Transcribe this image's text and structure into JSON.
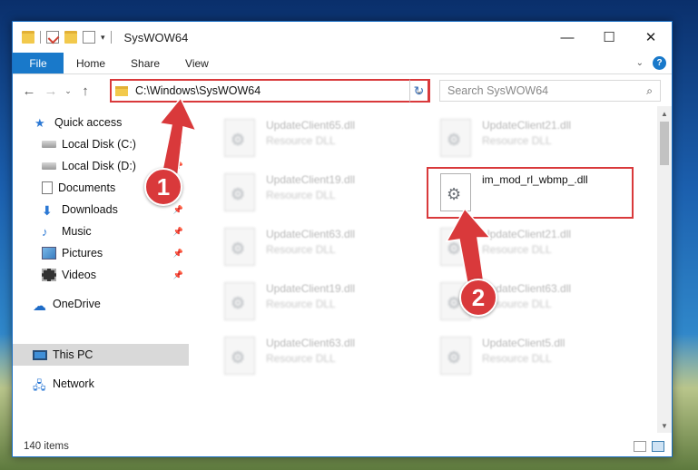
{
  "window": {
    "title": "SysWOW64",
    "buttons": {
      "minimize": "—",
      "maximize": "☐",
      "close": "✕"
    }
  },
  "ribbon": {
    "tabs": [
      "File",
      "Home",
      "Share",
      "View"
    ],
    "help": "?"
  },
  "navigation": {
    "address": "C:\\Windows\\SysWOW64",
    "search_placeholder": "Search SysWOW64"
  },
  "sidebar": {
    "items": [
      {
        "label": "Quick access",
        "icon": "star-icon"
      },
      {
        "label": "Local Disk (C:)",
        "icon": "disk-icon",
        "pinned": true
      },
      {
        "label": "Local Disk (D:)",
        "icon": "disk-icon",
        "pinned": true
      },
      {
        "label": "Documents",
        "icon": "documents-icon",
        "pinned": true
      },
      {
        "label": "Downloads",
        "icon": "downloads-icon",
        "pinned": true
      },
      {
        "label": "Music",
        "icon": "music-icon",
        "pinned": true
      },
      {
        "label": "Pictures",
        "icon": "pictures-icon",
        "pinned": true
      },
      {
        "label": "Videos",
        "icon": "videos-icon",
        "pinned": true
      },
      {
        "label": "OneDrive",
        "icon": "onedrive-icon"
      },
      {
        "label": "This PC",
        "icon": "this-pc-icon",
        "selected": true
      },
      {
        "label": "Network",
        "icon": "network-icon"
      }
    ]
  },
  "files": [
    {
      "name": "UpdateClient65.dll",
      "type": "Resource DLL"
    },
    {
      "name": "UpdateClient21.dll",
      "type": "Resource DLL"
    },
    {
      "name": "UpdateClient19.dll",
      "type": "Resource DLL"
    },
    {
      "name": "im_mod_rl_wbmp_.dll",
      "type": ""
    },
    {
      "name": "UpdateClient63.dll",
      "type": "Resource DLL"
    },
    {
      "name": "UpdateClient21.dll",
      "type": "Resource DLL"
    },
    {
      "name": "UpdateClient19.dll",
      "type": "Resource DLL"
    },
    {
      "name": "UpdateClient63.dll",
      "type": "Resource DLL"
    },
    {
      "name": "UpdateClient63.dll",
      "type": "Resource DLL"
    },
    {
      "name": "UpdateClient5.dll",
      "type": "Resource DLL"
    }
  ],
  "status": {
    "item_count": "140 items"
  },
  "annotations": {
    "step1": "1",
    "step2": "2"
  },
  "colors": {
    "accent": "#1979ca",
    "highlight": "#d9393b"
  }
}
